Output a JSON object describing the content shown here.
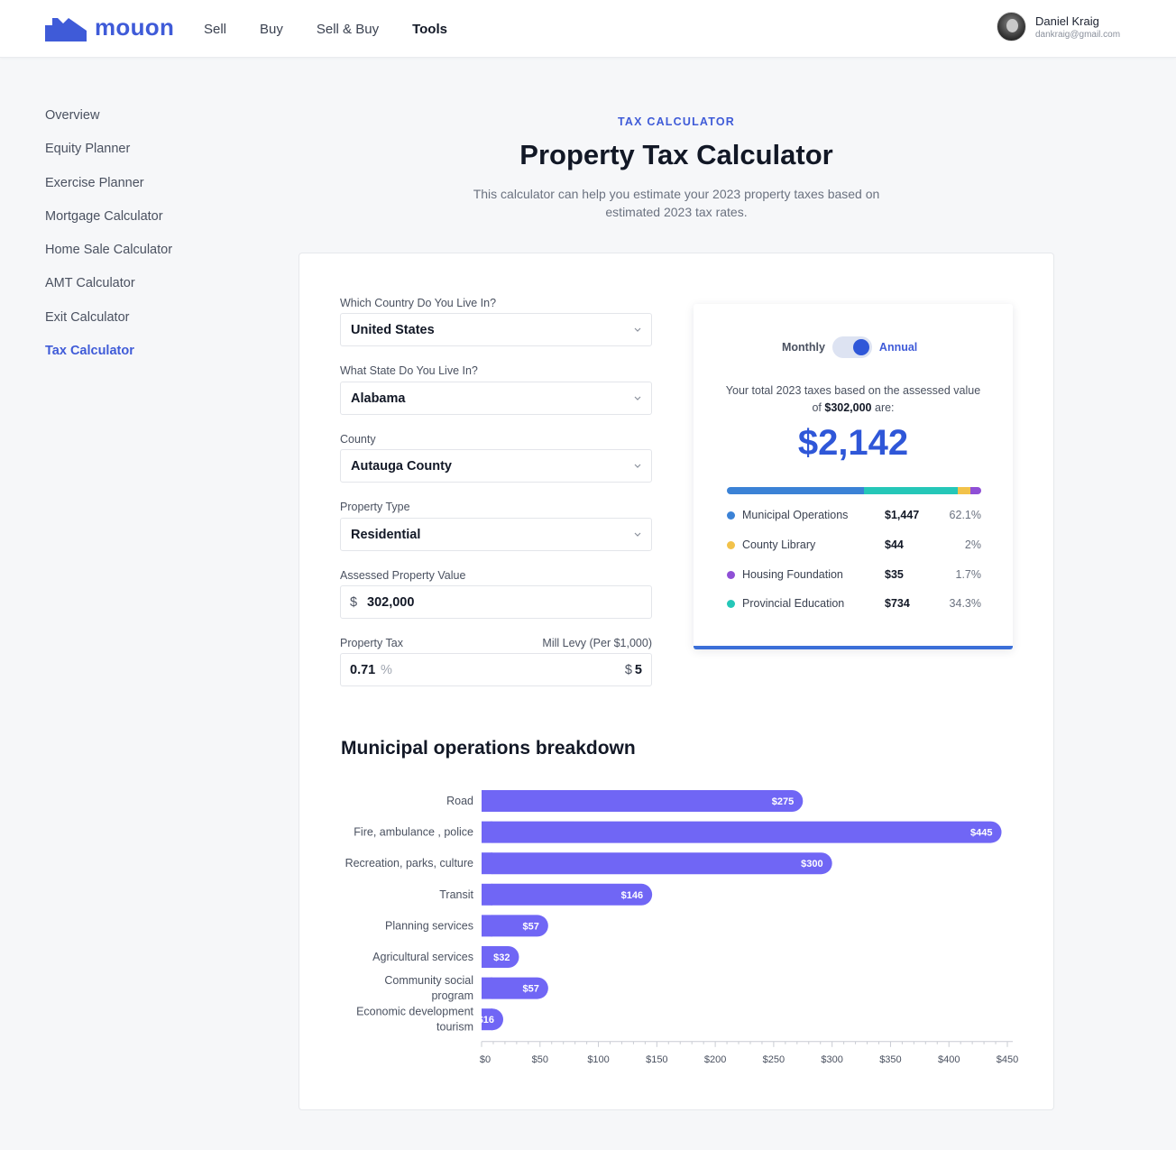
{
  "brand": {
    "name": "mouon",
    "accent": "#3f5bd8"
  },
  "nav": [
    {
      "label": "Sell",
      "active": false
    },
    {
      "label": "Buy",
      "active": false
    },
    {
      "label": "Sell & Buy",
      "active": false
    },
    {
      "label": "Tools",
      "active": true
    }
  ],
  "user": {
    "name": "Daniel Kraig",
    "email": "dankraig@gmail.com"
  },
  "sidebar": {
    "items": [
      {
        "label": "Overview",
        "active": false
      },
      {
        "label": "Equity Planner",
        "active": false
      },
      {
        "label": "Exercise Planner",
        "active": false
      },
      {
        "label": "Mortgage Calculator",
        "active": false
      },
      {
        "label": "Home Sale Calculator",
        "active": false
      },
      {
        "label": "AMT Calculator",
        "active": false
      },
      {
        "label": "Exit Calculator",
        "active": false
      },
      {
        "label": "Tax Calculator",
        "active": true
      }
    ]
  },
  "header": {
    "eyebrow": "TAX CALCULATOR",
    "title": "Property Tax Calculator",
    "subtitle": "This calculator can help you estimate your 2023 property taxes based on estimated 2023 tax rates."
  },
  "form": {
    "country": {
      "label": "Which Country Do You Live In?",
      "value": "United States"
    },
    "state": {
      "label": "What State Do You Live In?",
      "value": "Alabama"
    },
    "county": {
      "label": "County",
      "value": "Autauga County"
    },
    "property_type": {
      "label": "Property Type",
      "value": "Residential"
    },
    "assessed_value": {
      "label": "Assessed Property Value",
      "prefix": "$",
      "value": "302,000"
    },
    "property_tax": {
      "label": "Property Tax",
      "value": "0.71",
      "unit": "%"
    },
    "mill_levy": {
      "label": "Mill Levy (Per $1,000)",
      "prefix": "$",
      "value": "5"
    }
  },
  "result": {
    "toggle_left": "Monthly",
    "toggle_right": "Annual",
    "annual_selected": true,
    "desc_prefix": "Your total 2023 taxes based on the assessed value of ",
    "desc_value": "$302,000",
    "desc_suffix": " are:",
    "total": "$2,142",
    "breakdown": [
      {
        "name": "Municipal Operations",
        "amount": "$1,447",
        "percent": "62.1%",
        "color": "#3b82d6",
        "share": 0.539
      },
      {
        "name": "County Library",
        "amount": "$44",
        "percent": "2%",
        "color": "#f2c24a",
        "share": 0.049
      },
      {
        "name": "Housing Foundation",
        "amount": "$35",
        "percent": "1.7%",
        "color": "#8f4fd6",
        "share": 0.043
      },
      {
        "name": "Provincial Education",
        "amount": "$734",
        "percent": "34.3%",
        "color": "#25c7b8",
        "share": 0.369
      }
    ],
    "stack_order": [
      0,
      3,
      1,
      2
    ]
  },
  "chart_data": {
    "type": "bar",
    "orientation": "horizontal",
    "title": "Municipal operations breakdown",
    "categories": [
      "Road",
      "Fire, ambulance , police",
      "Recreation, parks, culture",
      "Transit",
      "Planning services",
      "Agricultural services",
      "Community social program",
      "Economic development tourism"
    ],
    "category_lines": [
      [
        "Road"
      ],
      [
        "Fire, ambulance , police"
      ],
      [
        "Recreation, parks, culture"
      ],
      [
        "Transit"
      ],
      [
        "Planning services"
      ],
      [
        "Agricultural services"
      ],
      [
        "Community social",
        "program"
      ],
      [
        "Economic development",
        "tourism"
      ]
    ],
    "values": [
      275,
      445,
      300,
      146,
      57,
      32,
      57,
      16
    ],
    "labels": [
      "$275",
      "$445",
      "$300",
      "$146",
      "$57",
      "$32",
      "$57",
      "$16"
    ],
    "xticks": [
      0,
      50,
      100,
      150,
      200,
      250,
      300,
      350,
      400,
      450
    ],
    "xtick_labels": [
      "$0",
      "$50",
      "$100",
      "$150",
      "$200",
      "$250",
      "$300",
      "$350",
      "$400",
      "$450"
    ],
    "xlim": [
      0,
      450
    ],
    "bar_color": "#7066f5",
    "grid": false
  }
}
